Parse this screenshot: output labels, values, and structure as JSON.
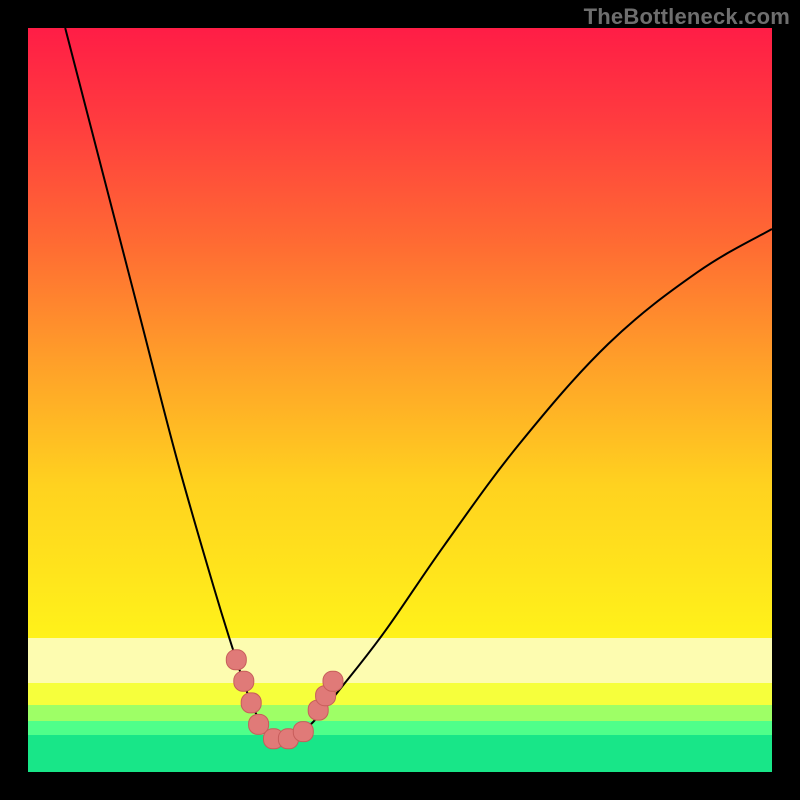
{
  "watermark": "TheBottleneck.com",
  "colors": {
    "frame": "#000000",
    "marker_fill": "#e07a78",
    "marker_stroke": "#c75d5b",
    "curve": "#000000",
    "gradient_top": "#ff1d46",
    "gradient_bottom": "#fff21a",
    "band_pale": "#fdfcb0",
    "band_green": "#18e688"
  },
  "chart_data": {
    "type": "line",
    "title": "",
    "xlabel": "",
    "ylabel": "",
    "x_range": [
      0,
      100
    ],
    "y_range_percent_bottleneck": [
      0,
      100
    ],
    "optimum_x": 34,
    "note": "V-shaped bottleneck curves on red→green gradient; minimum near x≈34 at y≈0; both limbs rise steeply.",
    "series": [
      {
        "name": "left-limb",
        "x": [
          5,
          10,
          15,
          20,
          25,
          28,
          30,
          32,
          34
        ],
        "y": [
          100,
          80,
          60,
          40,
          22,
          12,
          6,
          2,
          0
        ]
      },
      {
        "name": "right-limb",
        "x": [
          34,
          38,
          42,
          48,
          56,
          66,
          78,
          90,
          100
        ],
        "y": [
          0,
          3,
          8,
          16,
          28,
          42,
          56,
          66,
          72
        ]
      }
    ],
    "markers_near_minimum": [
      {
        "x": 28,
        "y": 12
      },
      {
        "x": 29,
        "y": 9
      },
      {
        "x": 30,
        "y": 6
      },
      {
        "x": 31,
        "y": 3
      },
      {
        "x": 33,
        "y": 1
      },
      {
        "x": 35,
        "y": 1
      },
      {
        "x": 37,
        "y": 2
      },
      {
        "x": 39,
        "y": 5
      },
      {
        "x": 40,
        "y": 7
      },
      {
        "x": 41,
        "y": 9
      }
    ]
  }
}
